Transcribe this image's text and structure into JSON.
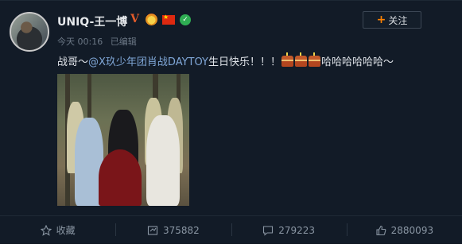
{
  "post": {
    "username": "UNIQ-王一博",
    "verified_badge": "V",
    "follow_label": "关注",
    "time": "今天 00:16",
    "edited": "已编辑",
    "content": {
      "prefix": "战哥～",
      "mention": "@X玖少年团肖战DAYTOY",
      "text": " 生日快乐！！！",
      "suffix": "哈哈哈哈哈哈～"
    }
  },
  "actions": {
    "favorite_label": "收藏",
    "repost_count": "375882",
    "comment_count": "279223",
    "like_count": "2880093"
  },
  "colors": {
    "background": "#121b27",
    "mention": "#7fa6d6",
    "accent": "#ff8200"
  }
}
